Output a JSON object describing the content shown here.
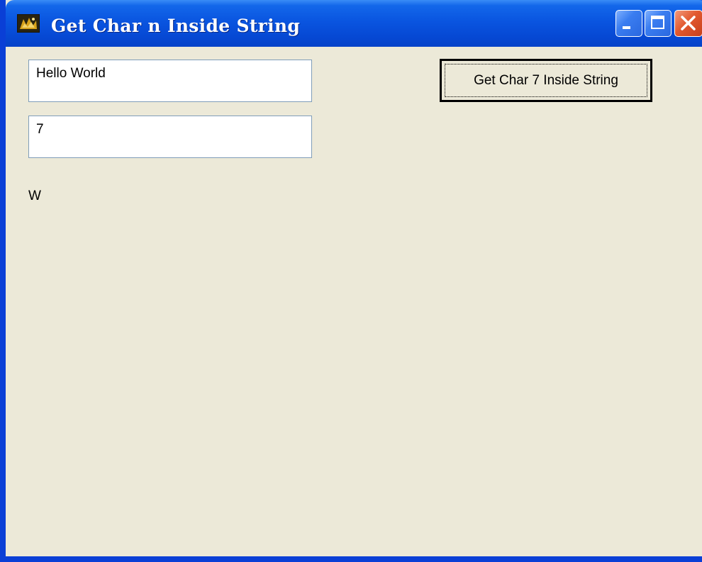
{
  "window": {
    "title": "Get Char n Inside String"
  },
  "titlebar_buttons": {
    "minimize_icon": "minimize-icon",
    "maximize_icon": "maximize-icon",
    "close_icon": "close-icon"
  },
  "form": {
    "string_input_value": "Hello World",
    "index_input_value": "7",
    "action_button_label": "Get Char 7 Inside String",
    "result_text": "W"
  },
  "colors": {
    "titlebar_blue": "#0a55e0",
    "close_button_red": "#e2592f",
    "window_background": "#ece9d8"
  }
}
